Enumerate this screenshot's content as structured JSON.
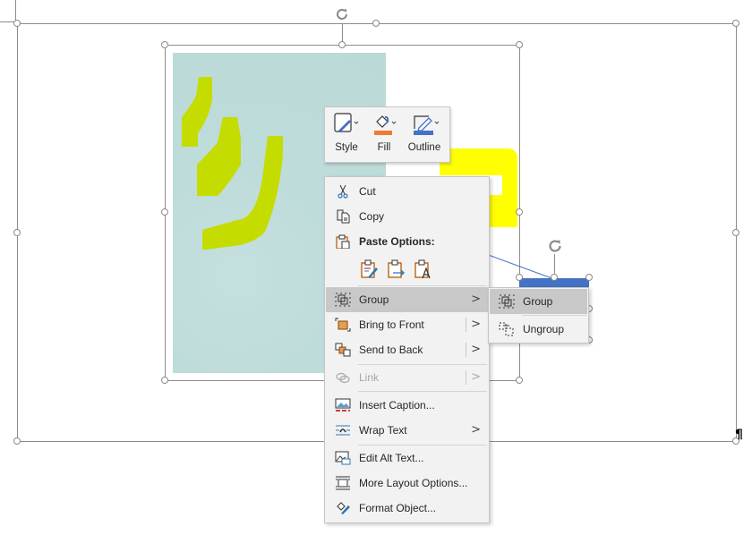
{
  "mini_toolbar": {
    "buttons": [
      {
        "label": "Style",
        "icon": "shape-style-icon"
      },
      {
        "label": "Fill",
        "icon": "paint-bucket-icon",
        "color": "#ed7d31"
      },
      {
        "label": "Outline",
        "icon": "pencil-outline-icon",
        "color": "#4472c4"
      }
    ]
  },
  "context_menu": {
    "items": [
      {
        "label": "Cut",
        "icon": "scissors-icon"
      },
      {
        "label": "Copy",
        "icon": "copy-icon"
      },
      {
        "label": "Paste Options:",
        "icon": "clipboard-icon"
      },
      {
        "label": "Group",
        "icon": "group-icon",
        "submenu": true,
        "highlighted": true
      },
      {
        "label": "Bring to Front",
        "icon": "bring-to-front-icon",
        "submenu": true
      },
      {
        "label": "Send to Back",
        "icon": "send-to-back-icon",
        "submenu": true
      },
      {
        "label": "Link",
        "icon": "link-icon",
        "submenu": true,
        "disabled": true
      },
      {
        "label": "Insert Caption...",
        "icon": "insert-caption-icon"
      },
      {
        "label": "Wrap Text",
        "icon": "wrap-text-icon",
        "submenu": true
      },
      {
        "label": "Edit Alt Text...",
        "icon": "alt-text-icon"
      },
      {
        "label": "More Layout Options...",
        "icon": "layout-options-icon"
      },
      {
        "label": "Format Object...",
        "icon": "format-object-icon"
      }
    ],
    "paste_options": [
      "paste-keep-formatting-icon",
      "paste-merge-icon",
      "paste-text-only-icon"
    ]
  },
  "submenu": {
    "items": [
      {
        "label": "Group",
        "icon": "group-icon",
        "highlighted": true
      },
      {
        "label": "Ungroup",
        "icon": "ungroup-icon"
      }
    ]
  },
  "document": {
    "paragraph_mark": "¶"
  },
  "colors": {
    "shape_blue": "#4472c4",
    "shape_yellow": "#ffff00",
    "stroke_green": "#c5dc00",
    "photo_bg": "#bedcda",
    "menu_bg": "#f2f2f2",
    "menu_highlight": "#c8c8c8"
  }
}
